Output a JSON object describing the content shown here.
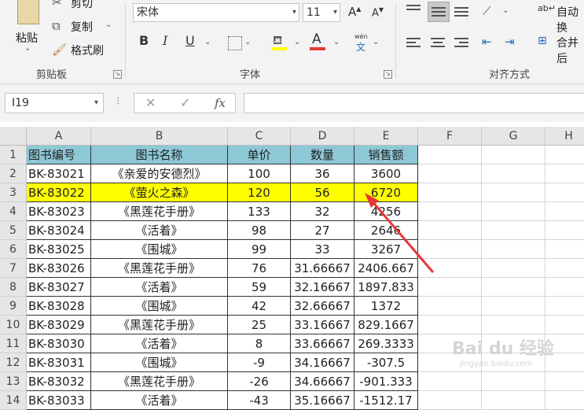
{
  "ribbon": {
    "clipboard": {
      "paste": "粘贴",
      "cut": "剪切",
      "copy": "复制",
      "format_painter": "格式刷",
      "group": "剪贴板"
    },
    "font": {
      "name": "宋体",
      "size": "11",
      "group": "字体",
      "bold": "B",
      "italic": "I",
      "underline": "U",
      "font_color_glyph": "A",
      "phonetic_top": "wén",
      "phonetic_bottom": "文"
    },
    "alignment": {
      "group": "对齐方式",
      "wrap_text": "自动换",
      "merge": "合并后"
    }
  },
  "formula_bar": {
    "name_box": "I19",
    "fx": "fx",
    "content": ""
  },
  "columns": [
    "A",
    "B",
    "C",
    "D",
    "E",
    "F",
    "G",
    "H"
  ],
  "rows": [
    [
      "图书编号",
      "图书名称",
      "单价",
      "数量",
      "销售额"
    ],
    [
      "BK-83021",
      "《亲爱的安德烈》",
      "100",
      "36",
      "3600"
    ],
    [
      "BK-83022",
      "《萤火之森》",
      "120",
      "56",
      "6720"
    ],
    [
      "BK-83023",
      "《黑莲花手册》",
      "133",
      "32",
      "4256"
    ],
    [
      "BK-83024",
      "《活着》",
      "98",
      "27",
      "2646"
    ],
    [
      "BK-83025",
      "《围城》",
      "99",
      "33",
      "3267"
    ],
    [
      "BK-83026",
      "《黑莲花手册》",
      "76",
      "31.66667",
      "2406.667"
    ],
    [
      "BK-83027",
      "《活着》",
      "59",
      "32.16667",
      "1897.833"
    ],
    [
      "BK-83028",
      "《围城》",
      "42",
      "32.66667",
      "1372"
    ],
    [
      "BK-83029",
      "《黑莲花手册》",
      "25",
      "33.16667",
      "829.1667"
    ],
    [
      "BK-83030",
      "《活着》",
      "8",
      "33.66667",
      "269.3333"
    ],
    [
      "BK-83031",
      "《围城》",
      "-9",
      "34.16667",
      "-307.5"
    ],
    [
      "BK-83032",
      "《黑莲花手册》",
      "-26",
      "34.66667",
      "-901.333"
    ],
    [
      "BK-83033",
      "《活着》",
      "-43",
      "35.16667",
      "-1512.17"
    ]
  ],
  "row_numbers": [
    "1",
    "2",
    "3",
    "4",
    "5",
    "6",
    "7",
    "8",
    "9",
    "10",
    "11",
    "12",
    "13",
    "14"
  ],
  "watermark": {
    "main": "Bai du 经验",
    "sub": "jingyan.baidu.com"
  },
  "colors": {
    "header_fill": "#8dc8d6",
    "highlight_fill": "#ffff00",
    "arrow": "#e53935"
  }
}
